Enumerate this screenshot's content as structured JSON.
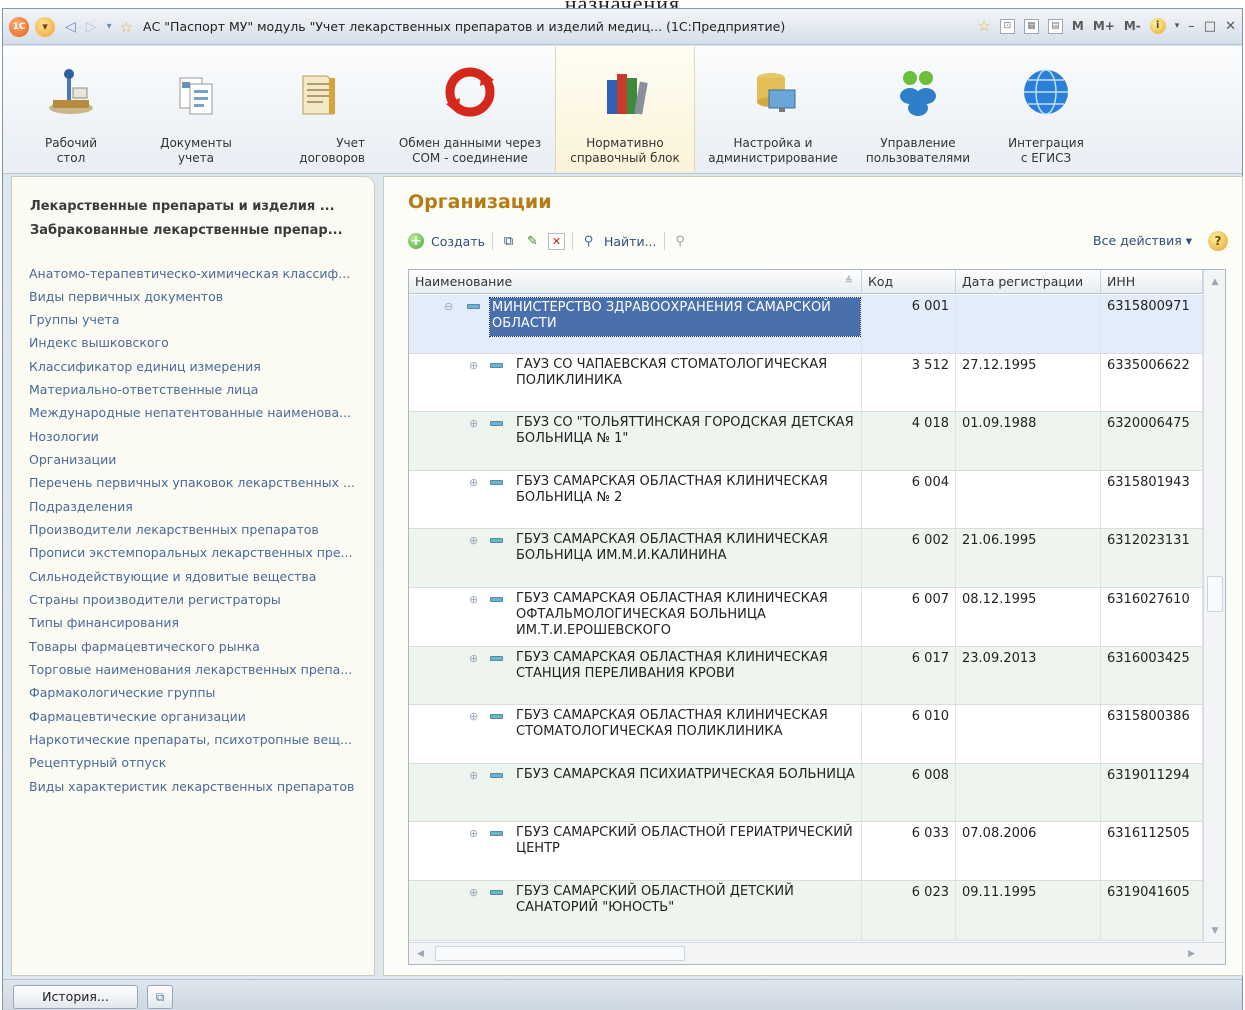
{
  "window": {
    "title": "АС \"Паспорт МУ\" модуль \"Учет лекарственных препаратов и изделий медиц... (1С:Предприятие)",
    "top_fragment": "назначения",
    "calc_m": "M",
    "calc_mplus": "M+",
    "calc_mminus": "M-",
    "logo_text": "1С"
  },
  "ribbon": [
    {
      "label": "Рабочий\nстол",
      "icon": "desk-icon"
    },
    {
      "label": "Документы\nучета",
      "icon": "documents-icon"
    },
    {
      "label": "Учет\nдоговоров",
      "icon": "contracts-icon"
    },
    {
      "label": "Обмен данными через\nCOM - соединение",
      "icon": "sync-icon"
    },
    {
      "label": "Нормативно\nсправочный блок",
      "icon": "books-icon"
    },
    {
      "label": "Настройка и\nадминистрирование",
      "icon": "admin-icon"
    },
    {
      "label": "Управление\nпользователями",
      "icon": "users-icon"
    },
    {
      "label": "Интеграция\nс ЕГИСЗ",
      "icon": "globe-icon"
    }
  ],
  "left": {
    "bold_items": [
      "Лекарственные препараты и изделия ...",
      "Забракованные лекарственные препар..."
    ],
    "items": [
      "Анатомо-терапевтическо-химическая классиф...",
      "Виды первичных документов",
      "Группы учета",
      "Индекс вышковского",
      "Классификатор единиц измерения",
      "Материально-ответственные лица",
      "Международные непатентованные наименова...",
      "Нозологии",
      "Организации",
      "Перечень первичных упаковок лекарственных ...",
      "Подразделения",
      "Производители лекарственных препаратов",
      "Прописи экстемпоральных лекарственных пре...",
      "Сильнодействующие и ядовитые вещества",
      "Страны производители регистраторы",
      "Типы финансирования",
      "Товары фармацевтического рынка",
      "Торговые наименования лекарственных препа...",
      "Фармакологические группы",
      "Фармацевтические организации",
      "Наркотические препараты, психотропные вещ...",
      "Рецептурный отпуск",
      "Виды характеристик лекарственных препаратов"
    ]
  },
  "main": {
    "title": "Организации",
    "toolbar": {
      "create": "Создать",
      "find": "Найти...",
      "all_actions": "Все действия ▾",
      "help": "?"
    },
    "columns": [
      "Наименование",
      "Код",
      "Дата регистрации",
      "ИНН"
    ],
    "rows": [
      {
        "name": "МИНИСТЕРСТВО ЗДРАВООХРАНЕНИЯ САМАРСКОЙ ОБЛАСТИ",
        "code": "6 001",
        "date": "",
        "inn": "6315800971"
      },
      {
        "name": "ГАУЗ СО ЧАПАЕВСКАЯ СТОМАТОЛОГИЧЕСКАЯ ПОЛИКЛИНИКА",
        "code": "3 512",
        "date": "27.12.1995",
        "inn": "6335006622"
      },
      {
        "name": "ГБУЗ СО \"ТОЛЬЯТТИНСКАЯ ГОРОДСКАЯ ДЕТСКАЯ БОЛЬНИЦА № 1\"",
        "code": "4 018",
        "date": "01.09.1988",
        "inn": "6320006475"
      },
      {
        "name": "ГБУЗ САМАРСКАЯ ОБЛАСТНАЯ КЛИНИЧЕСКАЯ БОЛЬНИЦА № 2",
        "code": "6 004",
        "date": "",
        "inn": "6315801943"
      },
      {
        "name": "ГБУЗ САМАРСКАЯ ОБЛАСТНАЯ КЛИНИЧЕСКАЯ БОЛЬНИЦА ИМ.М.И.КАЛИНИНА",
        "code": "6 002",
        "date": "21.06.1995",
        "inn": "6312023131"
      },
      {
        "name": "ГБУЗ САМАРСКАЯ ОБЛАСТНАЯ КЛИНИЧЕСКАЯ ОФТАЛЬМОЛОГИЧЕСКАЯ БОЛЬНИЦА ИМ.Т.И.ЕРОШЕВСКОГО",
        "code": "6 007",
        "date": "08.12.1995",
        "inn": "6316027610"
      },
      {
        "name": "ГБУЗ САМАРСКАЯ ОБЛАСТНАЯ КЛИНИЧЕСКАЯ СТАНЦИЯ ПЕРЕЛИВАНИЯ КРОВИ",
        "code": "6 017",
        "date": "23.09.2013",
        "inn": "6316003425"
      },
      {
        "name": "ГБУЗ САМАРСКАЯ ОБЛАСТНАЯ КЛИНИЧЕСКАЯ СТОМАТОЛОГИЧЕСКАЯ ПОЛИКЛИНИКА",
        "code": "6 010",
        "date": "",
        "inn": "6315800386"
      },
      {
        "name": "ГБУЗ САМАРСКАЯ ПСИХИАТРИЧЕСКАЯ БОЛЬНИЦА",
        "code": "6 008",
        "date": "",
        "inn": "6319011294"
      },
      {
        "name": "ГБУЗ САМАРСКИЙ ОБЛАСТНОЙ ГЕРИАТРИЧЕСКИЙ ЦЕНТР",
        "code": "6 033",
        "date": "07.08.2006",
        "inn": "6316112505"
      },
      {
        "name": "ГБУЗ САМАРСКИЙ ОБЛАСТНОЙ ДЕТСКИЙ САНАТОРИЙ \"ЮНОСТЬ\"",
        "code": "6 023",
        "date": "09.11.1995",
        "inn": "6319041605"
      }
    ]
  },
  "status": {
    "history": "История..."
  },
  "colors": {
    "accent": "#b57b14",
    "selection": "#4a6fad",
    "link": "#4a6a95"
  }
}
